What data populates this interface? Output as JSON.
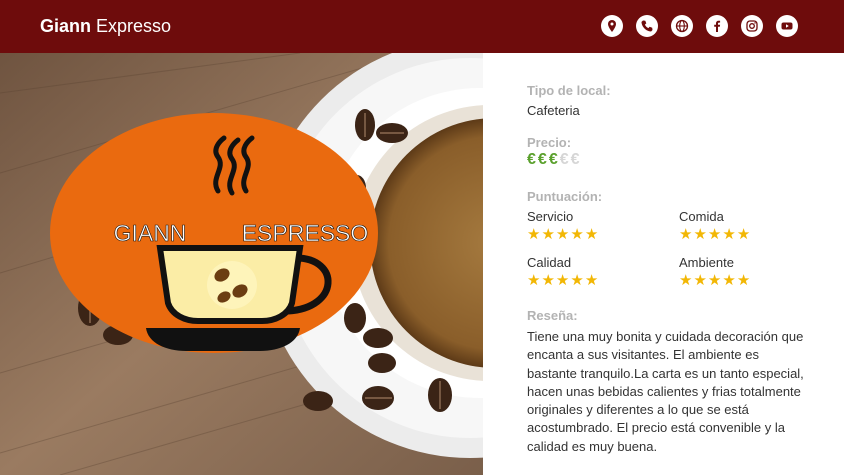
{
  "header": {
    "brand_bold": "Giann",
    "brand_rest": " Expresso",
    "icons": [
      "location-icon",
      "phone-icon",
      "web-icon",
      "facebook-icon",
      "instagram-icon",
      "youtube-icon"
    ]
  },
  "hero": {
    "logo_left": "GIANN",
    "logo_right": "ESPRESSO",
    "logo_color": "#ea6a0f"
  },
  "details": {
    "tipo_label": "Tipo de local:",
    "tipo_value": "Cafeteria",
    "precio_label": "Precio:",
    "price_symbol": "€",
    "price_level": 3,
    "price_max": 5,
    "puntuacion_label": "Puntuación:",
    "ratings": [
      {
        "label": "Servicio",
        "stars": 5
      },
      {
        "label": "Comida",
        "stars": 5
      },
      {
        "label": "Calidad",
        "stars": 5
      },
      {
        "label": "Ambiente",
        "stars": 5
      }
    ],
    "resena_label": "Reseña:",
    "resena_text": "Tiene una muy bonita y cuidada decoración que encanta a sus visitantes. El ambiente es bastante tranquilo.La carta es un tanto especial, hacen unas bebidas calientes y frias totalmente originales y diferentes a lo que se está acostumbrado. El precio está convenible y la calidad es muy buena."
  },
  "colors": {
    "header_bg": "#6e0c0c",
    "price_active": "#5aa02c",
    "star": "#f2b705",
    "label_gray": "#b3b3b3"
  }
}
